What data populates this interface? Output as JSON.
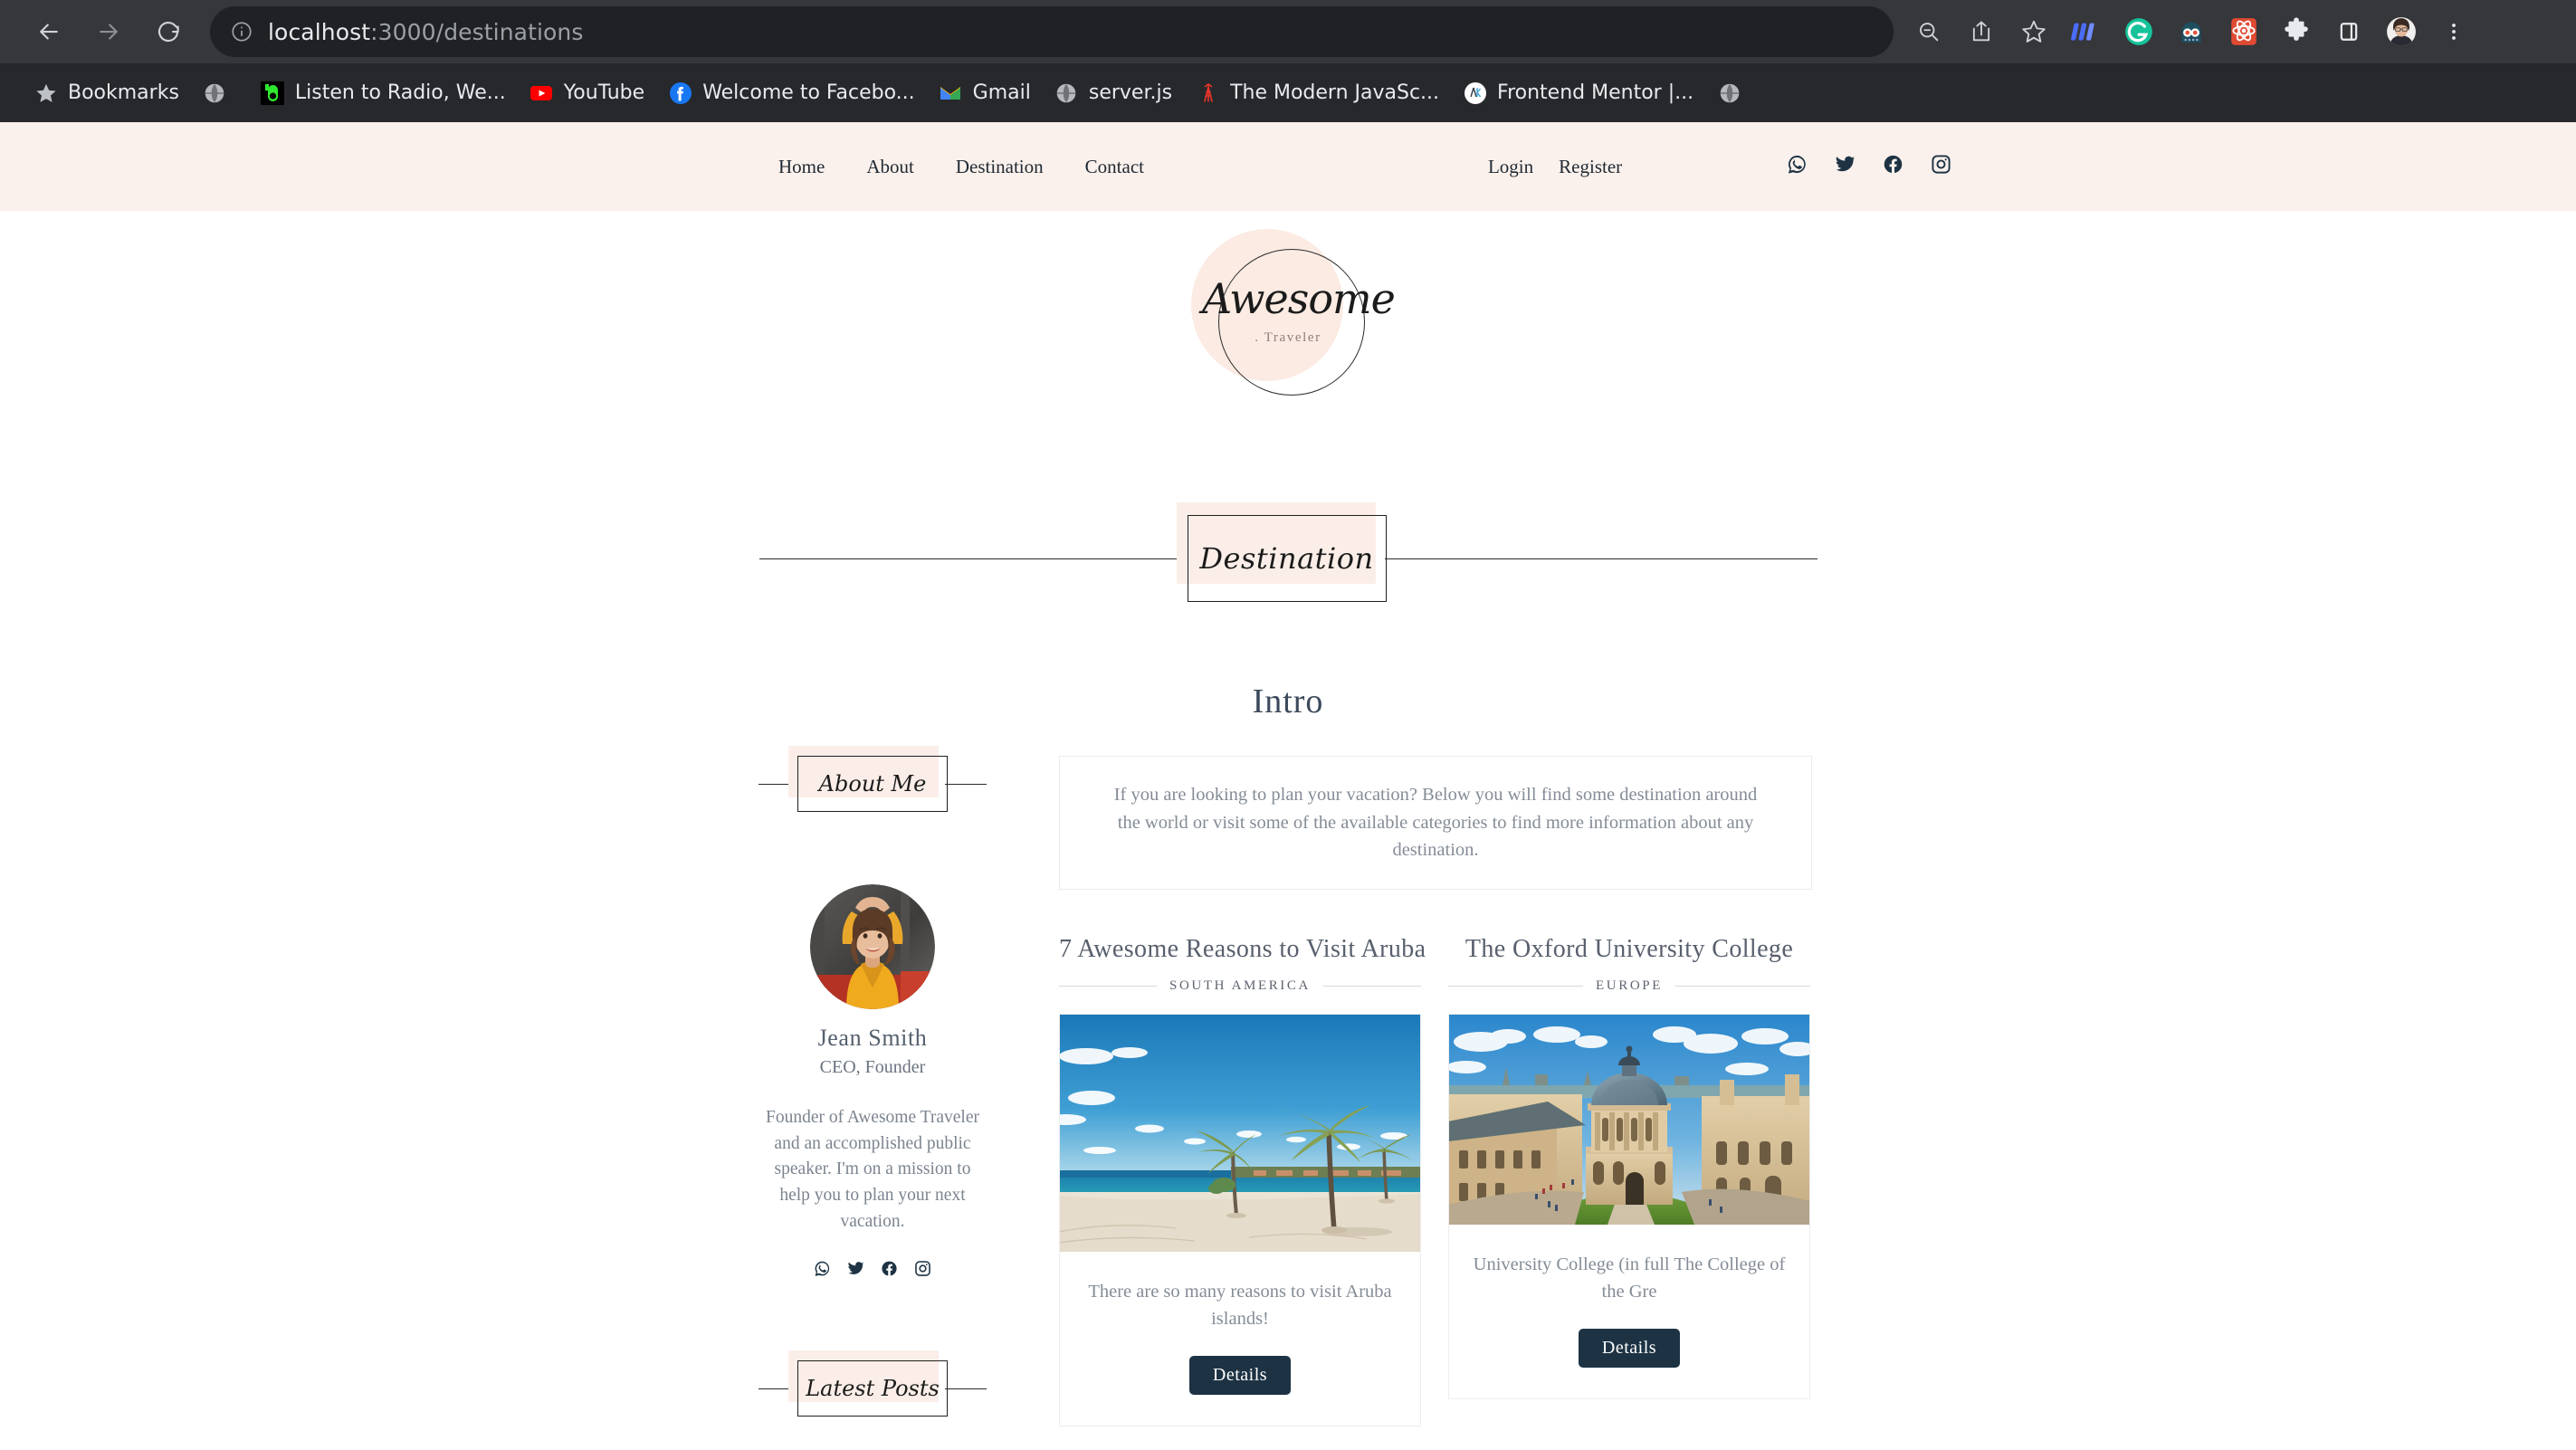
{
  "browser": {
    "nav": {
      "back": "back-arrow",
      "forward": "forward-arrow",
      "reload": "reload"
    },
    "url_full": "localhost:3000/destinations",
    "url_host": "localhost",
    "url_path": ":3000/destinations",
    "toolbar_icons": [
      "zoom-out-icon",
      "share-icon",
      "bookmark-star-icon",
      "monica-extension-icon",
      "grammarly-extension-icon",
      "ghostery-extension-icon",
      "react-devtools-extension-icon",
      "puzzle-extensions-icon",
      "side-panel-icon",
      "profile-avatar",
      "chrome-menu-icon"
    ],
    "bookmarks": [
      {
        "label": "Bookmarks",
        "icon": "star-icon"
      },
      {
        "label": "",
        "icon": "globe-icon"
      },
      {
        "label": "Listen to Radio, We...",
        "icon": "radio-icon"
      },
      {
        "label": "YouTube",
        "icon": "youtube-icon"
      },
      {
        "label": "Welcome to Facebo...",
        "icon": "facebook-icon"
      },
      {
        "label": "Gmail",
        "icon": "gmail-icon"
      },
      {
        "label": "server.js",
        "icon": "globe-icon"
      },
      {
        "label": "The Modern JavaSc...",
        "icon": "javascript-info-icon"
      },
      {
        "label": "Frontend Mentor |...",
        "icon": "frontend-mentor-icon"
      },
      {
        "label": "",
        "icon": "globe-icon"
      }
    ]
  },
  "site": {
    "nav": [
      {
        "label": "Home"
      },
      {
        "label": "About"
      },
      {
        "label": "Destination"
      },
      {
        "label": "Contact"
      }
    ],
    "auth": [
      {
        "label": "Login"
      },
      {
        "label": "Register"
      }
    ],
    "social": [
      "whatsapp-icon",
      "twitter-icon",
      "facebook-icon",
      "instagram-icon"
    ],
    "logo": {
      "brand": "Awesome",
      "sub": ". Traveler"
    },
    "page_title": "Destination",
    "intro_heading": "Intro",
    "about_badge": "About Me",
    "latest_posts_badge": "Latest Posts",
    "intro_text": "If you are looking to plan your vacation? Below you will find some destination around the world or visit some of the available categories to find more information about any destination.",
    "author": {
      "name": "Jean Smith",
      "role": "CEO, Founder",
      "bio": "Founder of Awesome Traveler and an accomplished public speaker. I'm on a mission to help you to plan your next vacation.",
      "social": [
        "whatsapp-icon",
        "twitter-icon",
        "facebook-icon",
        "instagram-icon"
      ]
    },
    "destinations": [
      {
        "title": "7 Awesome Reasons to Visit Aruba",
        "category": "SOUTH AMERICA",
        "image": "beach-with-palm-trees",
        "text": "There are so many reasons to visit Aruba islands!",
        "button": "Details"
      },
      {
        "title": "The Oxford University College",
        "category": "EUROPE",
        "image": "oxford-radcliffe-camera",
        "text": "University College (in full The College of the Gre",
        "button": "Details"
      }
    ]
  },
  "colors": {
    "header_bg": "#fbf1ec",
    "accent_blush": "#fbeee8",
    "button_navy": "#1d3344",
    "text_muted": "#848c96",
    "chrome_dark": "#26282b"
  }
}
